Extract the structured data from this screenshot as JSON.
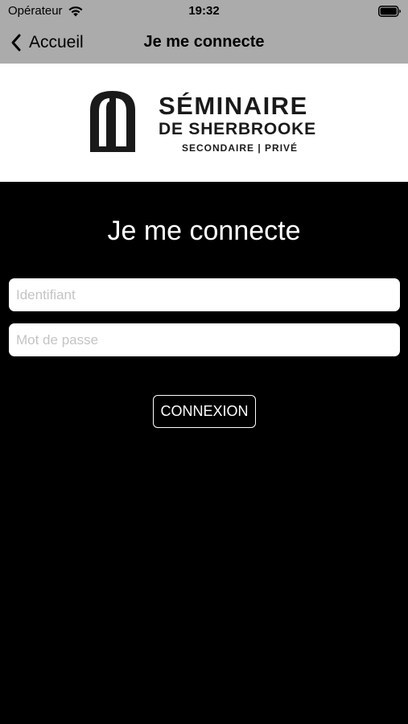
{
  "status_bar": {
    "carrier": "Opérateur",
    "time": "19:32",
    "wifi_icon": "wifi-icon",
    "battery_icon": "battery-icon"
  },
  "nav_bar": {
    "back_label": "Accueil",
    "back_icon": "chevron-left-icon",
    "title": "Je me connecte"
  },
  "logo": {
    "name": "SÉMINAIRE",
    "city": "DE SHERBROOKE",
    "tagline": "SECONDAIRE | PRIVÉ"
  },
  "login": {
    "heading": "Je me connecte",
    "username_placeholder": "Identifiant",
    "username_value": "",
    "password_placeholder": "Mot de passe",
    "password_value": "",
    "submit_label": "CONNEXION"
  },
  "colors": {
    "header_bg": "#ababab",
    "page_bg": "#000000",
    "logo_bg": "#ffffff",
    "text_light": "#ffffff"
  }
}
